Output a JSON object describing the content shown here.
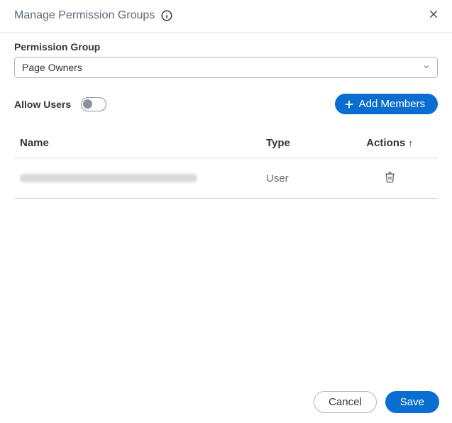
{
  "header": {
    "title": "Manage Permission Groups"
  },
  "form": {
    "permissionGroup": {
      "label": "Permission Group",
      "selected": "Page Owners"
    },
    "allowUsers": {
      "label": "Allow Users",
      "enabled": false
    }
  },
  "actions": {
    "addMembers": "Add Members"
  },
  "table": {
    "columns": {
      "name": "Name",
      "type": "Type",
      "actions": "Actions"
    },
    "sort": {
      "column": "actions",
      "direction": "asc",
      "indicator": "↑"
    },
    "rows": [
      {
        "name_redacted": true,
        "type": "User"
      }
    ]
  },
  "footer": {
    "cancel": "Cancel",
    "save": "Save"
  }
}
